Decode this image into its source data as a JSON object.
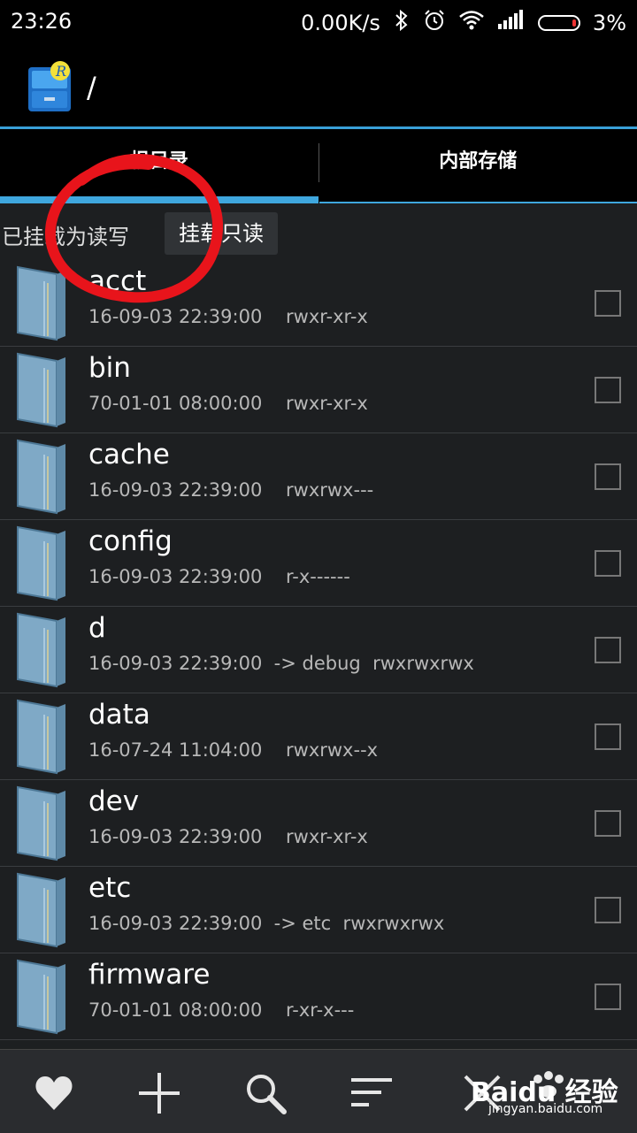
{
  "statusbar": {
    "time": "23:26",
    "speed": "0.00K/s",
    "battery": "3%",
    "battery_level": 0.03
  },
  "title": {
    "path": "/"
  },
  "tabs": [
    {
      "label": "根目录",
      "active": true
    },
    {
      "label": "内部存储",
      "active": false
    }
  ],
  "mount": {
    "status": "已挂载为读写",
    "button": "挂载只读"
  },
  "files": [
    {
      "name": "acct",
      "meta": "16-09-03 22:39:00    rwxr-xr-x"
    },
    {
      "name": "bin",
      "meta": "70-01-01 08:00:00    rwxr-xr-x"
    },
    {
      "name": "cache",
      "meta": "16-09-03 22:39:00    rwxrwx---"
    },
    {
      "name": "config",
      "meta": "16-09-03 22:39:00    r-x------"
    },
    {
      "name": "d",
      "meta": "16-09-03 22:39:00  -> debug  rwxrwxrwx"
    },
    {
      "name": "data",
      "meta": "16-07-24 11:04:00    rwxrwx--x"
    },
    {
      "name": "dev",
      "meta": "16-09-03 22:39:00    rwxr-xr-x"
    },
    {
      "name": "etc",
      "meta": "16-09-03 22:39:00  -> etc  rwxrwxrwx"
    },
    {
      "name": "firmware",
      "meta": "70-01-01 08:00:00    r-xr-x---"
    }
  ],
  "bottombar": {
    "icons": [
      "heart-icon",
      "plus-icon",
      "search-icon",
      "sort-icon",
      "close-icon"
    ]
  },
  "watermark": {
    "brand": "Baidu 经验",
    "url": "jingyan.baidu.com"
  },
  "colors": {
    "accent": "#3fa7de",
    "annotation": "#e8141b"
  }
}
